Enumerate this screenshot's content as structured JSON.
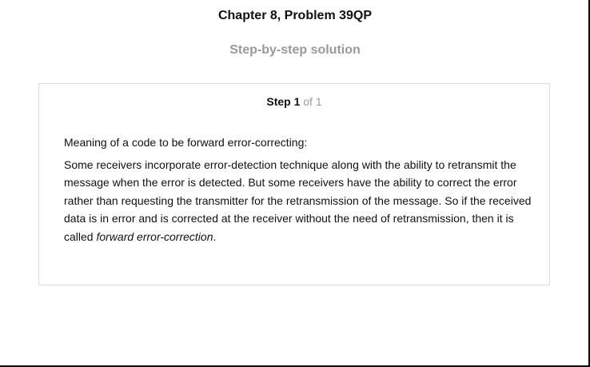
{
  "header": {
    "title": "Chapter 8, Problem 39QP",
    "subtitle": "Step-by-step solution"
  },
  "step": {
    "label": "Step 1",
    "of_text": "of 1",
    "heading": "Meaning of a code to be forward error-correcting:",
    "paragraph_main": "Some receivers incorporate error-detection technique along with the ability to retransmit the message when the error is detected. But some receivers have the ability to correct the error rather than requesting the transmitter for the retransmission of the message. So if the received data is in error and is corrected at the receiver without the need of retransmission, then it is called ",
    "paragraph_term": "forward error-correction",
    "paragraph_end": "."
  },
  "colors": {
    "muted_text": "#9a9a9a",
    "card_border": "#dcdcdc"
  }
}
